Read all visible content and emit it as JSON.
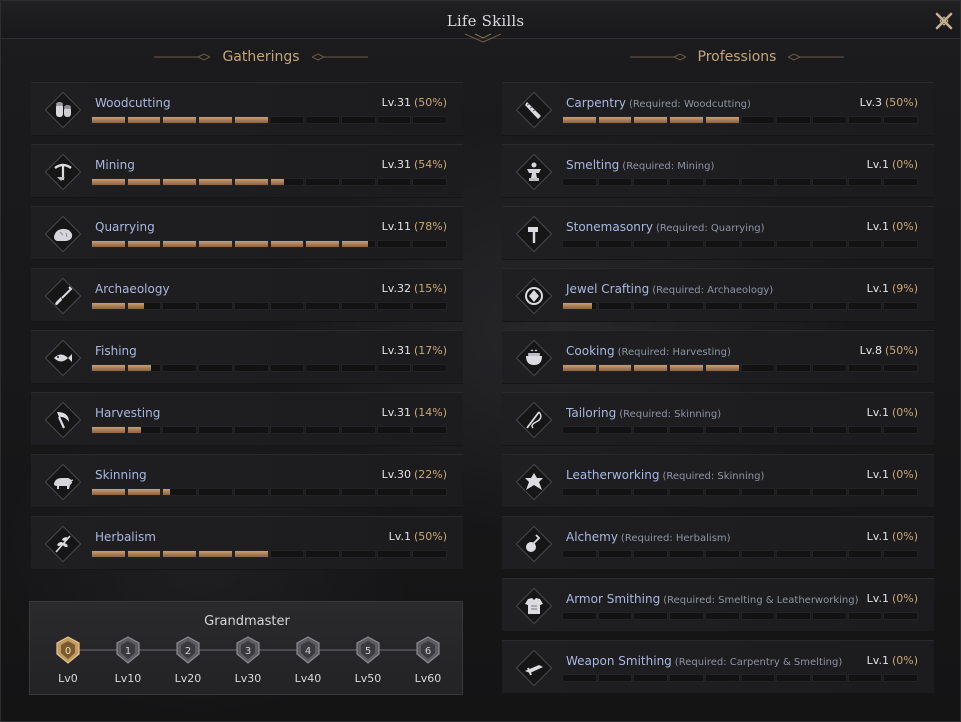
{
  "window": {
    "title": "Life Skills"
  },
  "sections": {
    "gatherings": "Gatherings",
    "professions": "Professions"
  },
  "colors": {
    "accent": "#c3a57b",
    "bar_fill": "#b08660",
    "name_text": "#a9b8e0"
  },
  "gatherings": [
    {
      "name": "Woodcutting",
      "level": "Lv.31",
      "percent": "(50%)",
      "progress": 0.5,
      "icon": "log-icon"
    },
    {
      "name": "Mining",
      "level": "Lv.31",
      "percent": "(54%)",
      "progress": 0.54,
      "icon": "pickaxe-icon"
    },
    {
      "name": "Quarrying",
      "level": "Lv.11",
      "percent": "(78%)",
      "progress": 0.78,
      "icon": "stone-icon"
    },
    {
      "name": "Archaeology",
      "level": "Lv.32",
      "percent": "(15%)",
      "progress": 0.15,
      "icon": "shovel-icon"
    },
    {
      "name": "Fishing",
      "level": "Lv.31",
      "percent": "(17%)",
      "progress": 0.17,
      "icon": "fish-icon"
    },
    {
      "name": "Harvesting",
      "level": "Lv.31",
      "percent": "(14%)",
      "progress": 0.14,
      "icon": "sickle-icon"
    },
    {
      "name": "Skinning",
      "level": "Lv.30",
      "percent": "(22%)",
      "progress": 0.22,
      "icon": "boar-icon"
    },
    {
      "name": "Herbalism",
      "level": "Lv.1",
      "percent": "(50%)",
      "progress": 0.5,
      "icon": "herb-icon"
    }
  ],
  "professions": [
    {
      "name": "Carpentry",
      "required": "(Required: Woodcutting)",
      "level": "Lv.3",
      "percent": "(50%)",
      "progress": 0.5,
      "icon": "saw-icon"
    },
    {
      "name": "Smelting",
      "required": "(Required: Mining)",
      "level": "Lv.1",
      "percent": "(0%)",
      "progress": 0,
      "icon": "anvil-icon"
    },
    {
      "name": "Stonemasonry",
      "required": "(Required: Quarrying)",
      "level": "Lv.1",
      "percent": "(0%)",
      "progress": 0,
      "icon": "hammer-icon"
    },
    {
      "name": "Jewel Crafting",
      "required": "(Required: Archaeology)",
      "level": "Lv.1",
      "percent": "(9%)",
      "progress": 0.09,
      "icon": "gem-icon"
    },
    {
      "name": "Cooking",
      "required": "(Required: Harvesting)",
      "level": "Lv.8",
      "percent": "(50%)",
      "progress": 0.5,
      "icon": "pot-icon"
    },
    {
      "name": "Tailoring",
      "required": "(Required: Skinning)",
      "level": "Lv.1",
      "percent": "(0%)",
      "progress": 0,
      "icon": "needle-icon"
    },
    {
      "name": "Leatherworking",
      "required": "(Required: Skinning)",
      "level": "Lv.1",
      "percent": "(0%)",
      "progress": 0,
      "icon": "hide-icon"
    },
    {
      "name": "Alchemy",
      "required": "(Required: Herbalism)",
      "level": "Lv.1",
      "percent": "(0%)",
      "progress": 0,
      "icon": "flask-icon"
    },
    {
      "name": "Armor Smithing",
      "required": "(Required: Smelting & Leatherworking)",
      "level": "Lv.1",
      "percent": "(0%)",
      "progress": 0,
      "icon": "armor-icon"
    },
    {
      "name": "Weapon Smithing",
      "required": "(Required: Carpentry & Smelting)",
      "level": "Lv.1",
      "percent": "(0%)",
      "progress": 0,
      "icon": "sword-icon"
    }
  ],
  "grandmaster": {
    "title": "Grandmaster",
    "active_index": 0,
    "tiers": [
      {
        "numeral": "0",
        "label": "Lv0"
      },
      {
        "numeral": "1",
        "label": "Lv10"
      },
      {
        "numeral": "2",
        "label": "Lv20"
      },
      {
        "numeral": "3",
        "label": "Lv30"
      },
      {
        "numeral": "4",
        "label": "Lv40"
      },
      {
        "numeral": "5",
        "label": "Lv50"
      },
      {
        "numeral": "6",
        "label": "Lv60"
      }
    ]
  }
}
